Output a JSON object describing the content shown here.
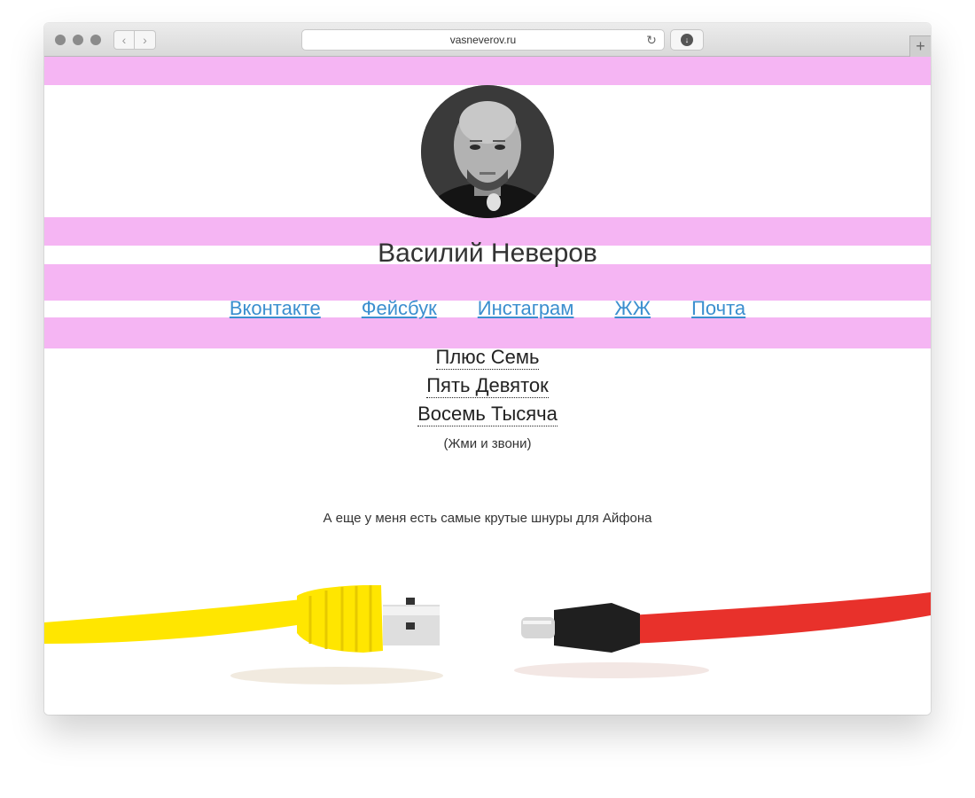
{
  "browser": {
    "url": "vasneverov.ru",
    "back_glyph": "‹",
    "forward_glyph": "›",
    "reload_glyph": "↻",
    "download_glyph": "↓",
    "new_tab_glyph": "+"
  },
  "profile": {
    "name": "Василий Неверов"
  },
  "social": {
    "links": [
      "Вконтакте",
      "Фейсбук",
      "Инстаграм",
      "ЖЖ",
      "Почта"
    ]
  },
  "phone": {
    "line1": "Плюс Семь",
    "line2": "Пять Девяток",
    "line3": "Восемь Тысяча",
    "hint": "(Жми и звони)"
  },
  "promo": {
    "text": "А еще у меня есть самые крутые шнуры для Айфона"
  },
  "colors": {
    "band": "#f5b5f3",
    "link": "#3b8fcf",
    "yellow_cable": "#ffe600",
    "red_cable": "#e8312b"
  },
  "icons": [
    "back-icon",
    "forward-icon",
    "reload-icon",
    "download-icon",
    "plus-icon"
  ]
}
